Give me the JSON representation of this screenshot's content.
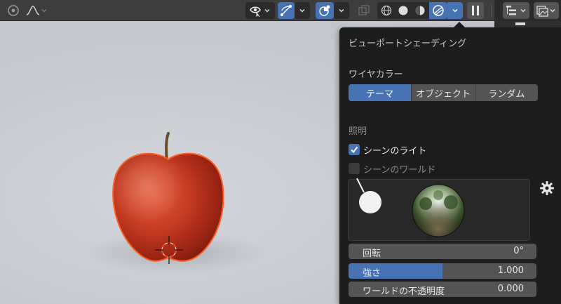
{
  "viewport": {
    "object": "apple"
  },
  "header": {
    "buttons": [
      {
        "name": "view-mode",
        "icon": "circle-dot-icon"
      },
      {
        "name": "curve",
        "icon": "curve-icon"
      },
      {
        "name": "visibility",
        "icon": "eye-cursor-icon"
      },
      {
        "name": "gizmo",
        "icon": "gizmo-icon"
      },
      {
        "name": "overlays",
        "icon": "overlay-sphere-icon"
      },
      {
        "name": "xray",
        "icon": "xray-icon"
      },
      {
        "name": "shading-wireframe",
        "icon": "wireframe-sphere-icon"
      },
      {
        "name": "shading-solid",
        "icon": "solid-sphere-icon"
      },
      {
        "name": "shading-material",
        "icon": "material-sphere-icon"
      },
      {
        "name": "shading-rendered",
        "icon": "rendered-sphere-icon"
      },
      {
        "name": "pause",
        "icon": "pause-icon"
      },
      {
        "name": "outliner-filter",
        "icon": "outliner-icon"
      },
      {
        "name": "image-display",
        "icon": "image-icon"
      }
    ]
  },
  "popover": {
    "title": "ビューポートシェーディング",
    "wire_color": {
      "label": "ワイヤカラー",
      "options": [
        "テーマ",
        "オブジェクト",
        "ランダム"
      ],
      "selected": "テーマ"
    },
    "lighting": {
      "label": "照明",
      "scene_lights": {
        "label": "シーンのライト",
        "checked": true
      },
      "scene_world": {
        "label": "シーンのワールド",
        "checked": false
      }
    },
    "rotation": {
      "label": "回転",
      "value": "0°"
    },
    "strength": {
      "label": "強さ",
      "value": "1.000",
      "fraction": 0.5
    },
    "world_opacity": {
      "label": "ワールドの不透明度",
      "value": "0.000"
    }
  },
  "colors": {
    "accent": "#4772b3",
    "panel_bg": "#1d1d1d",
    "header_bg": "#3d3d3d",
    "selection_outline": "#ff5a1e"
  }
}
